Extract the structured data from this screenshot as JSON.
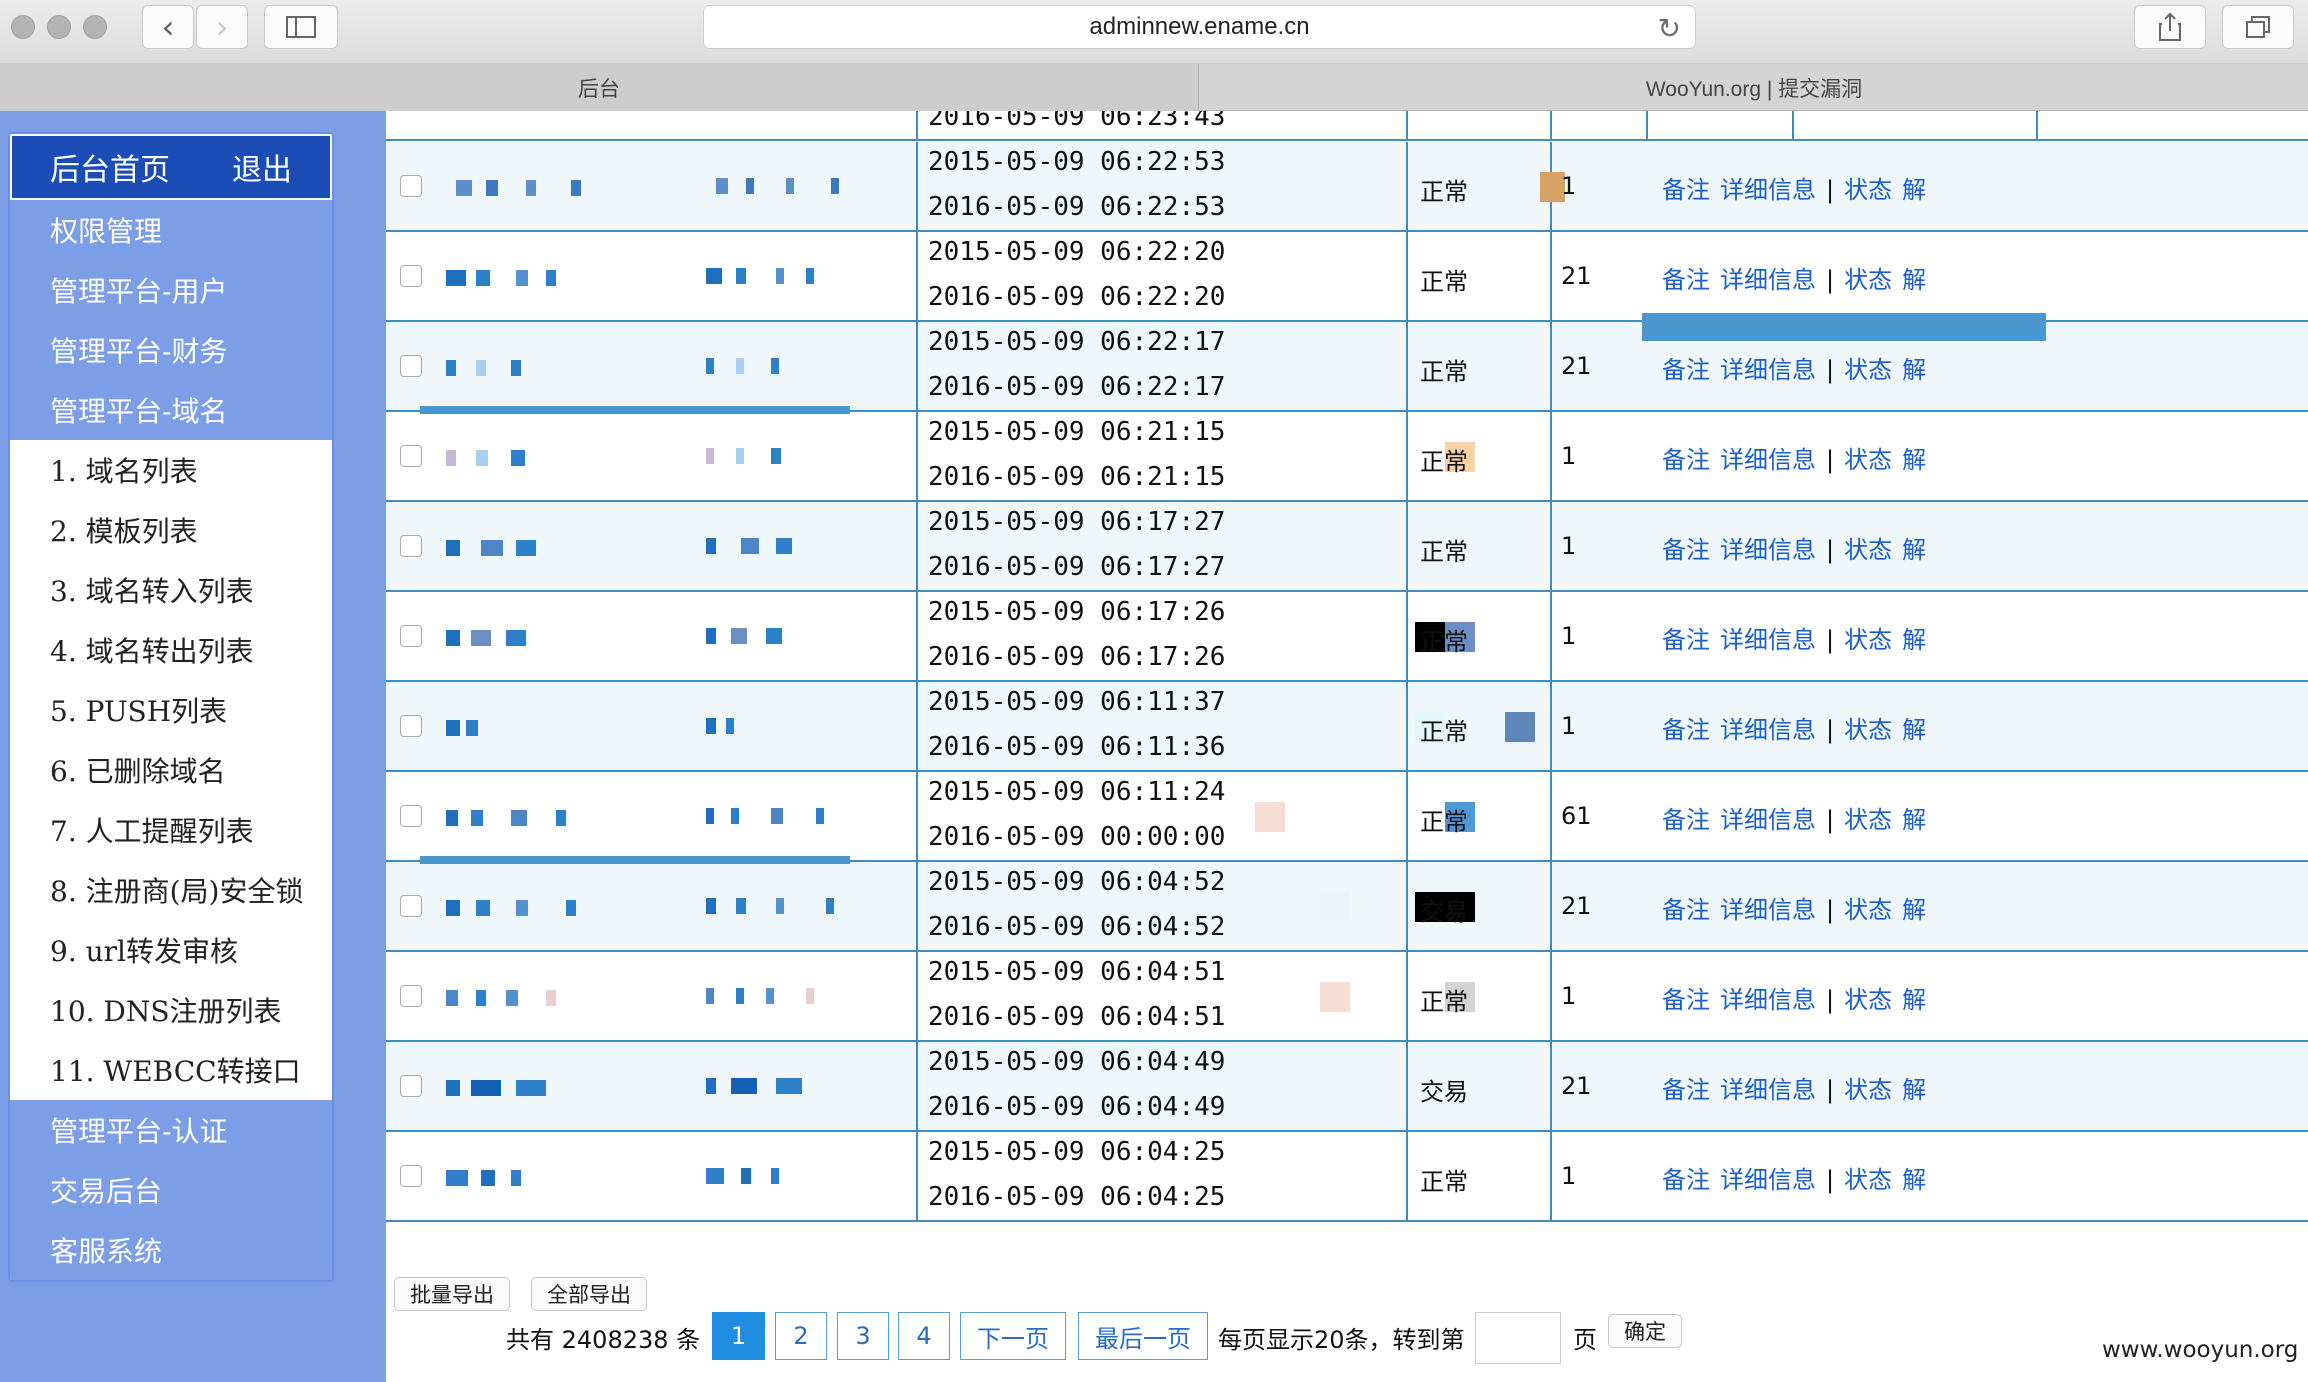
{
  "browser": {
    "url": "adminnew.ename.cn",
    "tabs": [
      "后台",
      "WooYun.org | 提交漏洞"
    ]
  },
  "sidebar": {
    "home": "后台首页",
    "logout": "退出",
    "groups_top": [
      "权限管理",
      "管理平台-用户",
      "管理平台-财务",
      "管理平台-域名"
    ],
    "items": [
      "1. 域名列表",
      "2. 模板列表",
      "3. 域名转入列表",
      "4. 域名转出列表",
      "5. PUSH列表",
      "6. 已删除域名",
      "7. 人工提醒列表",
      "8. 注册商(局)安全锁",
      "9. url转发审核",
      "10. DNS注册列表",
      "11. WEBCC转接口"
    ],
    "groups_bottom": [
      "管理平台-认证",
      "交易后台",
      "客服系统"
    ]
  },
  "table": {
    "partial_row": {
      "date2": "2016-05-09 06:23:43"
    },
    "rows": [
      {
        "date1": "2015-05-09 06:22:53",
        "date2": "2016-05-09 06:22:53",
        "status": "正常",
        "count": "1"
      },
      {
        "date1": "2015-05-09 06:22:20",
        "date2": "2016-05-09 06:22:20",
        "status": "正常",
        "count": "21"
      },
      {
        "date1": "2015-05-09 06:22:17",
        "date2": "2016-05-09 06:22:17",
        "status": "正常",
        "count": "21"
      },
      {
        "date1": "2015-05-09 06:21:15",
        "date2": "2016-05-09 06:21:15",
        "status": "正常",
        "count": "1"
      },
      {
        "date1": "2015-05-09 06:17:27",
        "date2": "2016-05-09 06:17:27",
        "status": "正常",
        "count": "1"
      },
      {
        "date1": "2015-05-09 06:17:26",
        "date2": "2016-05-09 06:17:26",
        "status": "正常",
        "count": "1"
      },
      {
        "date1": "2015-05-09 06:11:37",
        "date2": "2016-05-09 06:11:36",
        "status": "正常",
        "count": "1"
      },
      {
        "date1": "2015-05-09 06:11:24",
        "date2": "2016-05-09 00:00:00",
        "status": "正常",
        "count": "61"
      },
      {
        "date1": "2015-05-09 06:04:52",
        "date2": "2016-05-09 06:04:52",
        "status": "交易",
        "count": "21"
      },
      {
        "date1": "2015-05-09 06:04:51",
        "date2": "2016-05-09 06:04:51",
        "status": "正常",
        "count": "1"
      },
      {
        "date1": "2015-05-09 06:04:49",
        "date2": "2016-05-09 06:04:49",
        "status": "交易",
        "count": "21"
      },
      {
        "date1": "2015-05-09 06:04:25",
        "date2": "2016-05-09 06:04:25",
        "status": "正常",
        "count": "1"
      }
    ],
    "ops": {
      "note": "备注",
      "detail": "详细信息",
      "sep": "|",
      "status": "状态",
      "more": "解"
    }
  },
  "footer": {
    "export_selected": "批量导出",
    "export_all": "全部导出",
    "total_prefix": "共有",
    "total": "2408238",
    "total_suffix": "条",
    "pages": [
      "1",
      "2",
      "3",
      "4"
    ],
    "next": "下一页",
    "last": "最后一页",
    "per_page": "每页显示20条，转到第",
    "page_unit": "页",
    "confirm": "确定"
  },
  "watermark": "www.wooyun.org"
}
